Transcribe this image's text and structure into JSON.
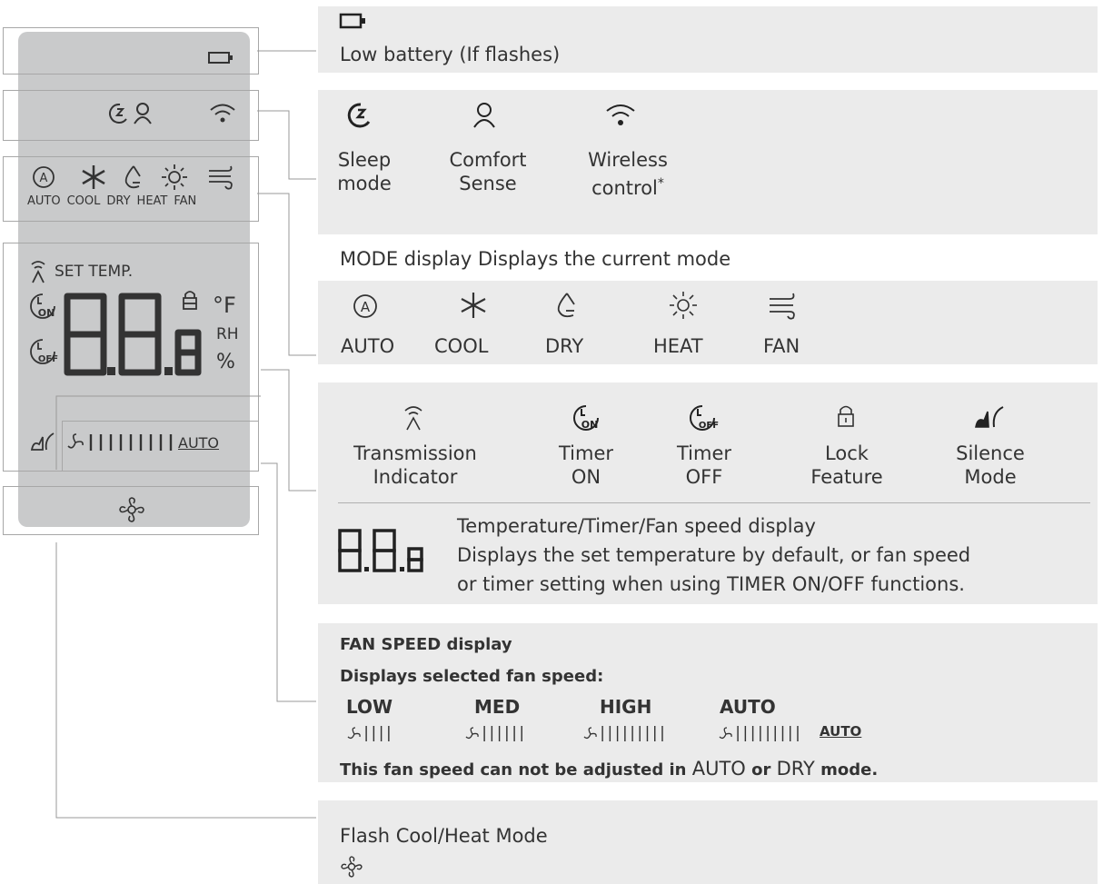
{
  "lcd": {
    "set_temp_label": "SET TEMP.",
    "unit_f": "°F",
    "unit_rh": "RH",
    "unit_pct": "%",
    "fan_auto": "AUTO",
    "modes": [
      "AUTO",
      "COOL",
      "DRY",
      "HEAT",
      "FAN"
    ]
  },
  "battery": {
    "text": "Low battery (If flashes)"
  },
  "status": {
    "items": [
      {
        "line1": "Sleep",
        "line2": "mode",
        "icon": "sleep-icon"
      },
      {
        "line1": "Comfort",
        "line2": "Sense",
        "icon": "comfort-sense-icon"
      },
      {
        "line1": "Wireless",
        "line2": "control",
        "icon": "wifi-icon",
        "mark": "*"
      }
    ]
  },
  "mode": {
    "title": "MODE display Displays the current mode",
    "items": [
      "AUTO",
      "COOL",
      "DRY",
      "HEAT",
      "FAN"
    ]
  },
  "indicators": {
    "items": [
      {
        "line1": "Transmission",
        "line2": "Indicator",
        "icon": "transmission-icon"
      },
      {
        "line1": "Timer",
        "line2": "ON",
        "icon": "timer-on-icon"
      },
      {
        "line1": "Timer",
        "line2": "OFF",
        "icon": "timer-off-icon"
      },
      {
        "line1": "Lock",
        "line2": "Feature",
        "icon": "lock-icon"
      },
      {
        "line1": "Silence",
        "line2": "Mode",
        "icon": "silence-icon"
      }
    ],
    "display_title": "Temperature/Timer/Fan speed display",
    "display_line2": "Displays the set temperature by default, or fan speed",
    "display_line3": "or timer setting when using TIMER ON/OFF functions."
  },
  "fan_speed": {
    "title": "FAN SPEED display",
    "subtitle": "Displays selected fan speed:",
    "levels": [
      {
        "label": "LOW",
        "bars": "||||"
      },
      {
        "label": "MED",
        "bars": "||||||"
      },
      {
        "label": "HIGH",
        "bars": "|||||||||"
      },
      {
        "label": "AUTO",
        "bars": "|||||||||",
        "tag": "AUTO"
      }
    ],
    "note_pre": "This fan speed can not be adjusted in ",
    "note_auto": "AUTO",
    "note_or": " or ",
    "note_dry": "DRY",
    "note_post": " mode."
  },
  "flash": {
    "title": "Flash Cool/Heat Mode"
  }
}
